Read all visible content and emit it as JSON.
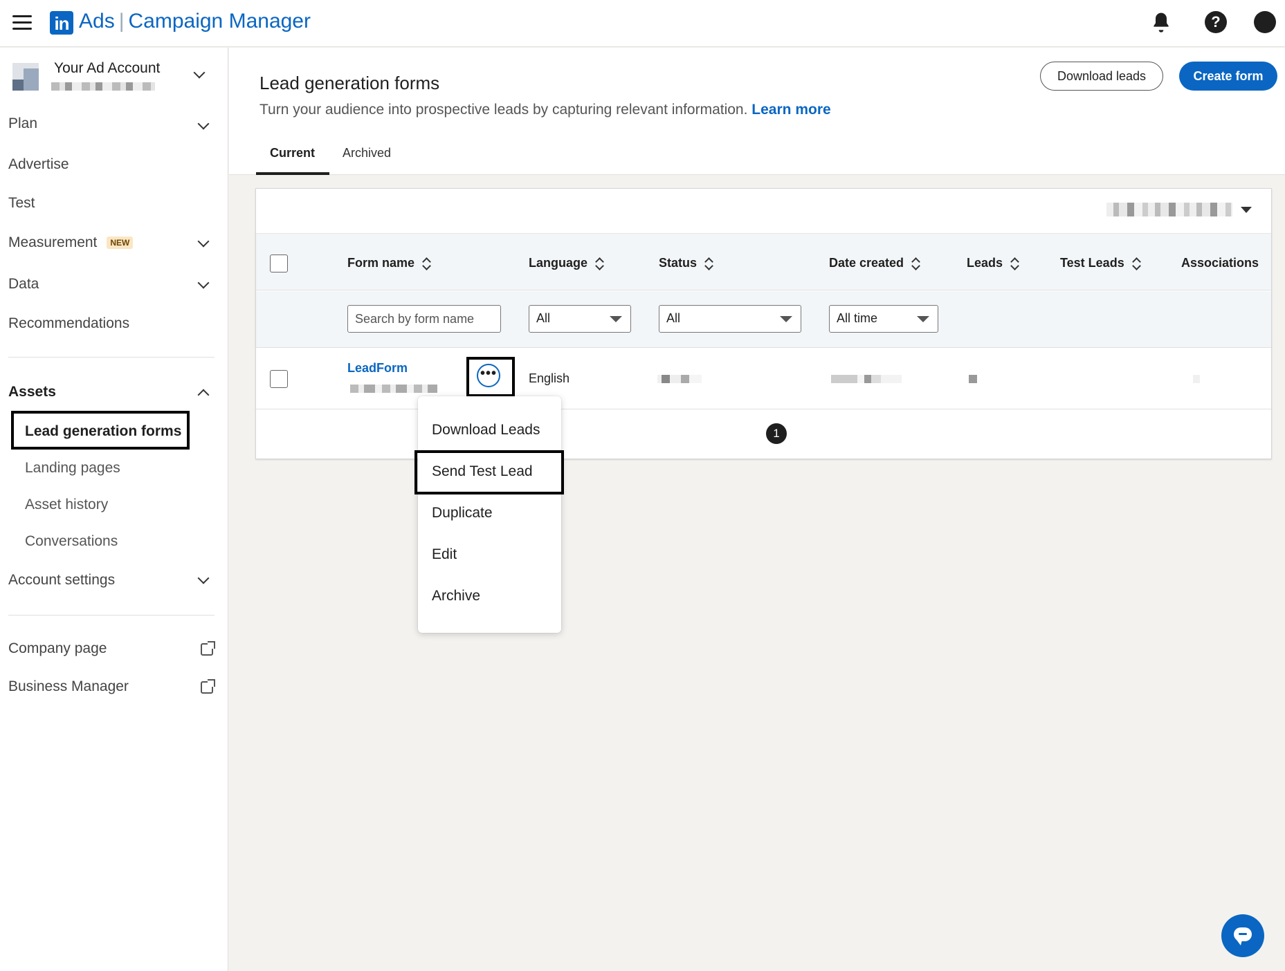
{
  "header": {
    "brand_ads": "Ads",
    "brand_product": "Campaign Manager",
    "logo_text": "in",
    "help_glyph": "?"
  },
  "sidebar": {
    "account_name": "Your Ad Account",
    "items": {
      "plan": "Plan",
      "advertise": "Advertise",
      "test": "Test",
      "measurement": "Measurement",
      "measurement_badge": "NEW",
      "data": "Data",
      "recommendations": "Recommendations",
      "assets": "Assets",
      "lead_forms": "Lead generation forms",
      "landing_pages": "Landing pages",
      "asset_history": "Asset history",
      "conversations": "Conversations",
      "account_settings": "Account settings",
      "company_page": "Company page",
      "business_manager": "Business Manager"
    }
  },
  "page": {
    "title": "Lead generation forms",
    "description": "Turn your audience into prospective leads by capturing relevant information.",
    "learn_more": "Learn more",
    "download_leads_button": "Download leads",
    "create_form_button": "Create form",
    "tabs": {
      "current": "Current",
      "archived": "Archived"
    }
  },
  "table": {
    "columns": {
      "form_name": "Form name",
      "language": "Language",
      "status": "Status",
      "date_created": "Date created",
      "leads": "Leads",
      "test_leads": "Test Leads",
      "associations": "Associations"
    },
    "filters": {
      "search_placeholder": "Search by form name",
      "language": "All",
      "status": "All",
      "date": "All time"
    },
    "rows": [
      {
        "form_name": "LeadForm",
        "language": "English"
      }
    ],
    "page_number": "1",
    "more_glyph": "•••"
  },
  "row_menu": {
    "items": {
      "download_leads": "Download Leads",
      "send_test_lead": "Send Test Lead",
      "duplicate": "Duplicate",
      "edit": "Edit",
      "archive": "Archive"
    }
  },
  "colors": {
    "brand_blue": "#0a66c2",
    "text": "#1f1f1f",
    "background": "#f3f2ef"
  },
  "icons": [
    "menu-icon",
    "bell-icon",
    "help-icon",
    "avatar",
    "chevron-down-icon",
    "chevron-up-icon",
    "external-link-icon",
    "sort-icon",
    "more-icon",
    "chat-icon"
  ]
}
